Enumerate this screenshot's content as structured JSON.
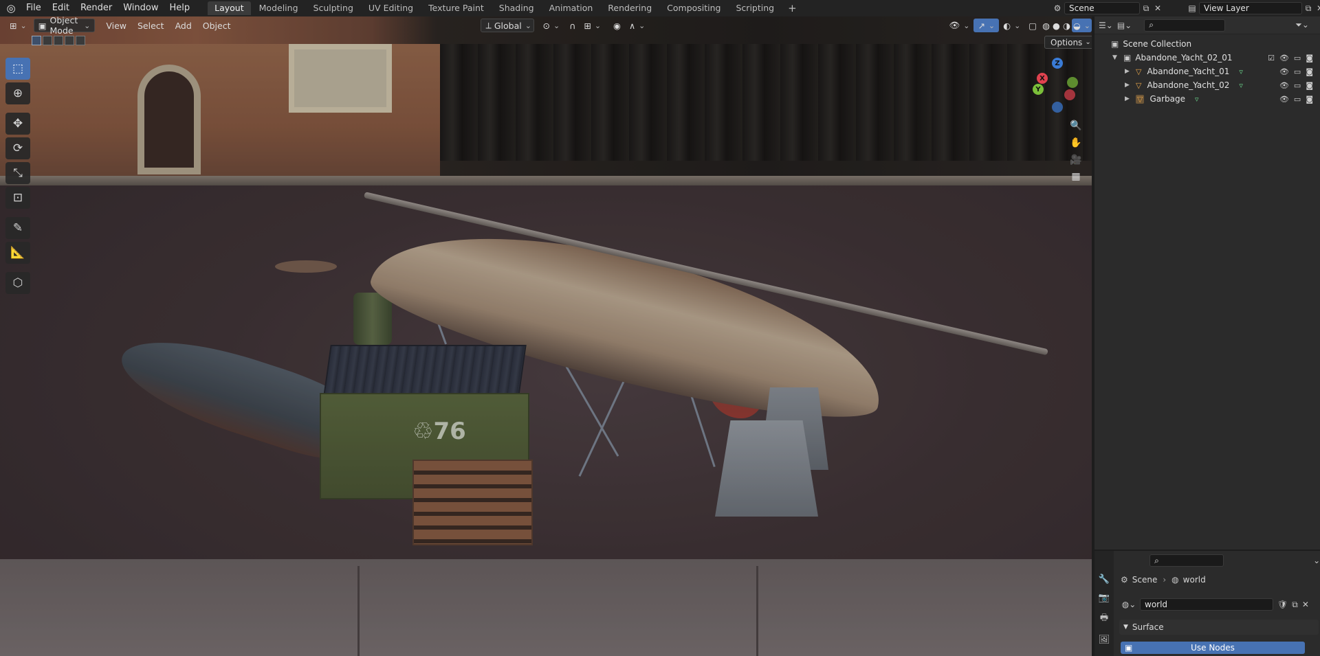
{
  "menus": [
    "File",
    "Edit",
    "Render",
    "Window",
    "Help"
  ],
  "workspaces": [
    "Layout",
    "Modeling",
    "Sculpting",
    "UV Editing",
    "Texture Paint",
    "Shading",
    "Animation",
    "Rendering",
    "Compositing",
    "Scripting"
  ],
  "active_workspace": "Layout",
  "add_workspace": "+",
  "scene": {
    "name": "Scene"
  },
  "view_layer": {
    "name": "View Layer"
  },
  "viewport": {
    "mode": "Object Mode",
    "menus": [
      "View",
      "Select",
      "Add",
      "Object"
    ],
    "transform_orientation": "Global",
    "options_label": "Options",
    "dumpster_label": "♲76"
  },
  "gizmo": {
    "x": "X",
    "y": "Y",
    "z": "Z"
  },
  "toolbar": [
    "select-box",
    "cursor",
    "move",
    "rotate",
    "scale",
    "transform",
    "annotate",
    "measure",
    "add-cube"
  ],
  "outliner": {
    "root": "Scene Collection",
    "collection": "Abandone_Yacht_02_01",
    "objects": [
      {
        "name": "Abandone_Yacht_01"
      },
      {
        "name": "Abandone_Yacht_02"
      },
      {
        "name": "Garbage"
      }
    ]
  },
  "properties": {
    "breadcrumb_scene": "Scene",
    "breadcrumb_sep": "›",
    "breadcrumb_world": "world",
    "world_name": "world",
    "panel": "Surface",
    "use_nodes": "Use Nodes"
  },
  "colors": {
    "accent": "#4772b3",
    "x_axis": "#e0424f",
    "y_axis": "#7bbf3a",
    "z_axis": "#3a7bd5"
  }
}
